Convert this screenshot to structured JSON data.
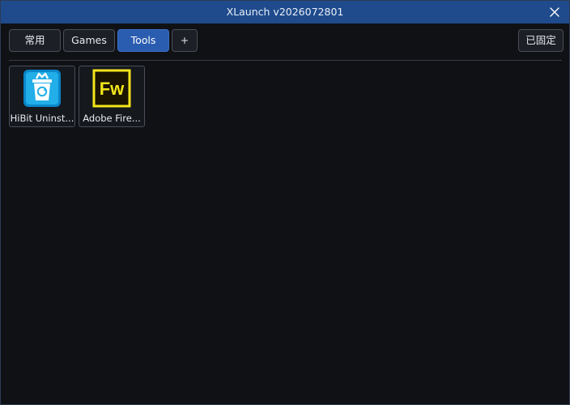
{
  "window": {
    "title": "XLaunch v2026072801"
  },
  "tabs": [
    {
      "label": "常用",
      "active": false
    },
    {
      "label": "Games",
      "active": false
    },
    {
      "label": "Tools",
      "active": true
    },
    {
      "label": "+",
      "active": false
    }
  ],
  "pin_button": {
    "label": "已固定"
  },
  "apps": [
    {
      "label": "HiBit Uninst...",
      "icon": "hibit-uninstaller-icon"
    },
    {
      "label": "Adobe Fire...",
      "icon": "adobe-fireworks-icon",
      "icon_text": "Fw"
    }
  ],
  "colors": {
    "titlebar": "#1f4b8c",
    "active_tab": "#2a5cb0",
    "background": "#0f1115",
    "fw_yellow": "#f2e51b"
  }
}
